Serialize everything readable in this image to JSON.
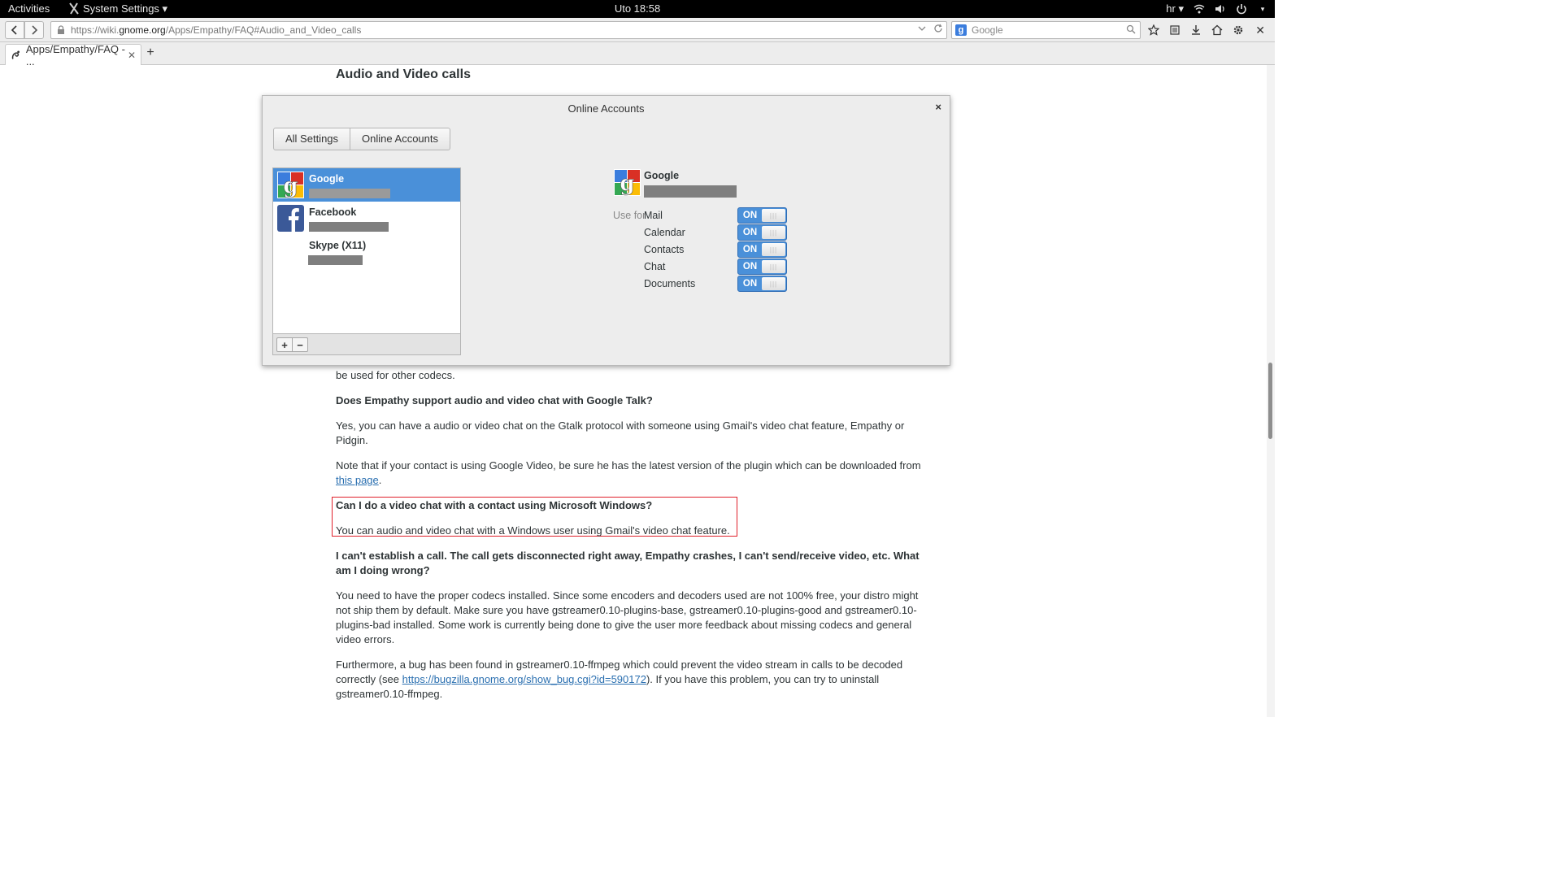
{
  "topbar": {
    "activities": "Activities",
    "app_menu": "System Settings ▾",
    "clock": "Uto 18:58",
    "lang": "hr ▾"
  },
  "browser": {
    "url_prefix": "https://wiki.",
    "url_host": "gnome.org",
    "url_path": "/Apps/Empathy/FAQ#Audio_and_Video_calls",
    "search_placeholder": "Google",
    "tab_title": "Apps/Empathy/FAQ - ...",
    "new_tab": "+"
  },
  "article": {
    "section_title": "Audio and Video calls",
    "partial_line": "be used for other codecs.",
    "q1": "Does Empathy support audio and video chat with Google Talk?",
    "a1": "Yes, you can have a audio or video chat on the Gtalk protocol with someone using Gmail's video chat feature, Empathy or Pidgin.",
    "a1b_text": "Note that if your contact is using Google Video, be sure he has the latest version of the plugin which can be downloaded from",
    "a1b_link": "this page",
    "q2": "Can I do a video chat with a contact using Microsoft Windows?",
    "a2": "You can audio and video chat with a Windows user using Gmail's video chat feature.",
    "q3": "I can't establish a call. The call gets disconnected right away, Empathy crashes, I can't send/receive video, etc. What am I doing wrong?",
    "a3": "You need to have the proper codecs installed. Since some encoders and decoders used are not 100% free, your distro might not ship them by default. Make sure you have gstreamer0.10-plugins-base, gstreamer0.10-plugins-good and gstreamer0.10-plugins-bad installed. Some work is currently being done to give the user more feedback about missing codecs and general video errors.",
    "a4_pre": "Furthermore, a bug has been found in gstreamer0.10-ffmpeg which could prevent the video stream in calls to be decoded correctly (see",
    "a4_link": "https://bugzilla.gnome.org/show_bug.cgi?id=590172",
    "a4_post": "). If you have this problem, you can try to uninstall gstreamer0.10-ffmpeg."
  },
  "dialog": {
    "title": "Online Accounts",
    "close": "×",
    "crumbs": [
      "All Settings",
      "Online Accounts"
    ],
    "accounts": [
      {
        "name": "Google"
      },
      {
        "name": "Facebook"
      },
      {
        "name": "Skype (X11)"
      }
    ],
    "add": "+",
    "remove": "−",
    "detail_name": "Google",
    "use_for": "Use for",
    "services": [
      {
        "label": "Mail",
        "state": "ON"
      },
      {
        "label": "Calendar",
        "state": "ON"
      },
      {
        "label": "Contacts",
        "state": "ON"
      },
      {
        "label": "Chat",
        "state": "ON"
      },
      {
        "label": "Documents",
        "state": "ON"
      }
    ]
  },
  "colors": {
    "selection": "#4a90d9",
    "link": "#2a6fb0",
    "highlight_border": "#e0202a"
  }
}
